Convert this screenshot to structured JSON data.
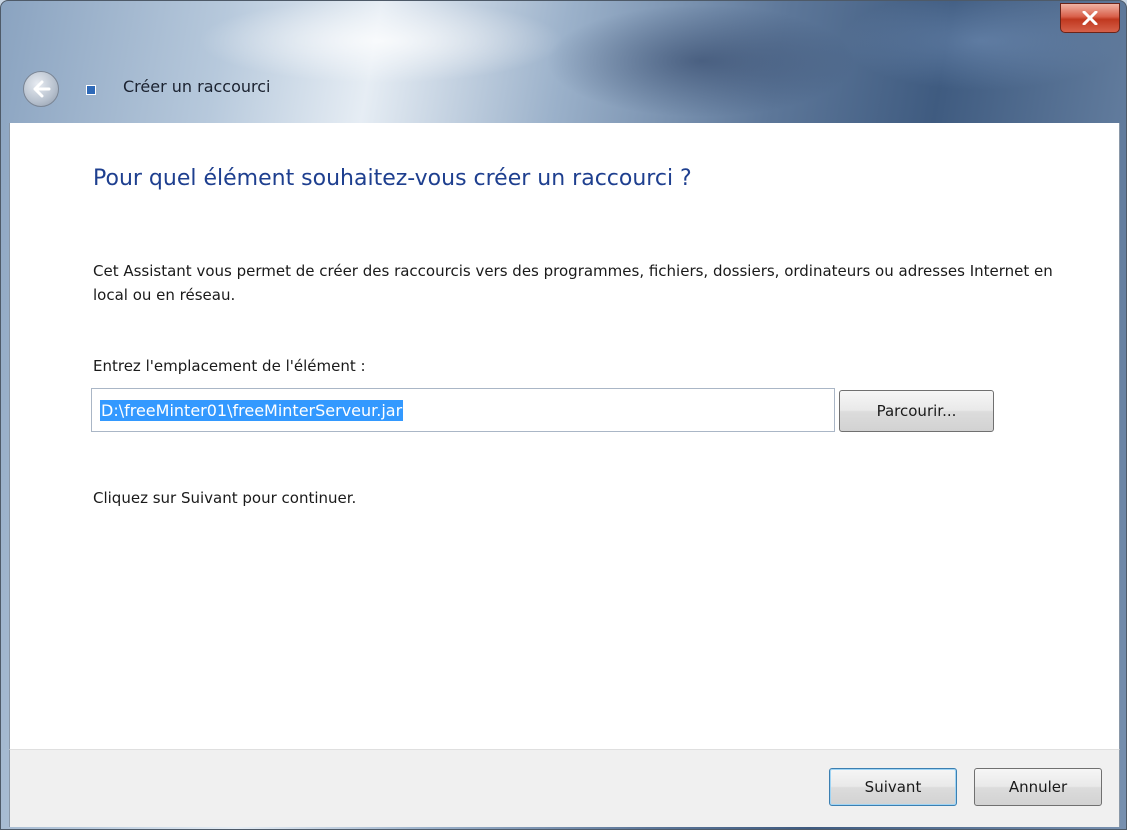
{
  "window": {
    "title": "Créer un raccourci"
  },
  "page": {
    "heading": "Pour quel élément souhaitez-vous créer un raccourci ?",
    "description": "Cet Assistant vous permet de créer des raccourcis vers des programmes, fichiers, dossiers, ordinateurs ou adresses Internet en local ou en réseau.",
    "field_label": "Entrez l'emplacement de l'élément :",
    "field_value": "D:\\freeMinter01\\freeMinterServeur.jar",
    "browse_label": "Parcourir...",
    "hint": "Cliquez sur Suivant pour continuer."
  },
  "footer": {
    "next_label": "Suivant",
    "cancel_label": "Annuler"
  },
  "icons": {
    "close": "close-icon",
    "back": "back-arrow-icon",
    "shortcut": "shortcut-icon"
  },
  "colors": {
    "heading": "#1e3f8f",
    "selection": "#3399ff",
    "close_button": "#c0381f"
  }
}
